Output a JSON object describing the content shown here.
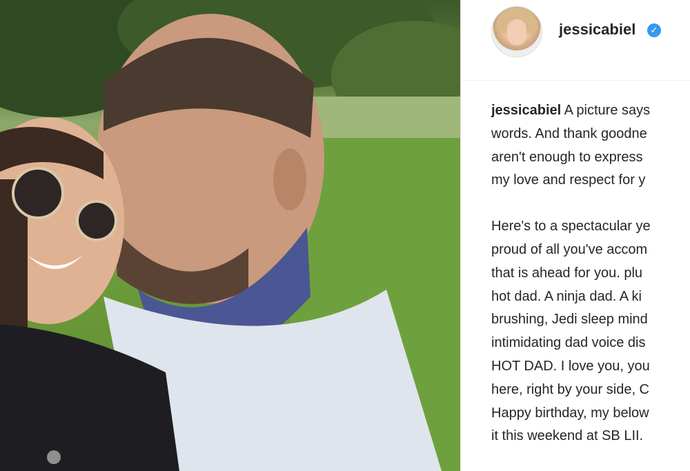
{
  "post": {
    "username": "jessicabiel",
    "verified_icon": "verified-badge-icon",
    "caption_lines": [
      "A picture says",
      "words. And thank goodne",
      "aren't enough to express",
      "my love and respect for y",
      "Here's to a spectacular ye",
      "proud of all you've accom",
      "that is ahead for you. plu",
      "hot dad. A ninja dad. A ki",
      "brushing, Jedi sleep mind",
      "intimidating dad voice dis",
      "HOT DAD. I love you, you",
      "here, right by your side, C",
      "Happy birthday, my below",
      "it this weekend at SB LII."
    ]
  },
  "colors": {
    "text": "#262626",
    "verified": "#3897f0",
    "divider": "#efefef"
  }
}
